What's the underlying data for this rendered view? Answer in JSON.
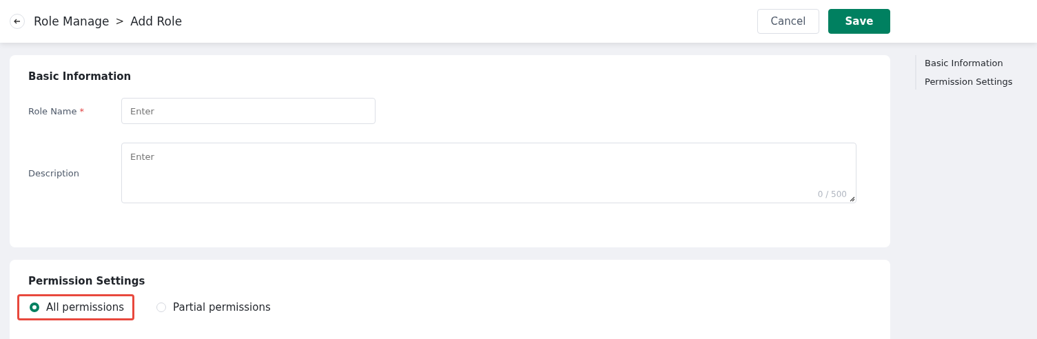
{
  "header": {
    "breadcrumb": [
      "Role Manage",
      "Add Role"
    ],
    "separator": ">",
    "buttons": [
      {
        "label": "Cancel",
        "kind": "secondary"
      },
      {
        "label": "Save",
        "kind": "primary"
      }
    ]
  },
  "basic": {
    "title": "Basic Information",
    "fields": [
      {
        "label": "Role Name",
        "required_mark": "*",
        "kind": "input",
        "placeholder": "Enter"
      },
      {
        "label": "Description",
        "kind": "textarea",
        "placeholder": "Enter",
        "counter": "0 / 500"
      }
    ]
  },
  "permissions": {
    "title": "Permission Settings",
    "options": [
      {
        "label": "All permissions",
        "selected": true,
        "highlighted": true
      },
      {
        "label": "Partial permissions",
        "selected": false,
        "highlighted": false
      }
    ]
  },
  "anchor_nav": [
    "Basic Information",
    "Permission Settings"
  ]
}
